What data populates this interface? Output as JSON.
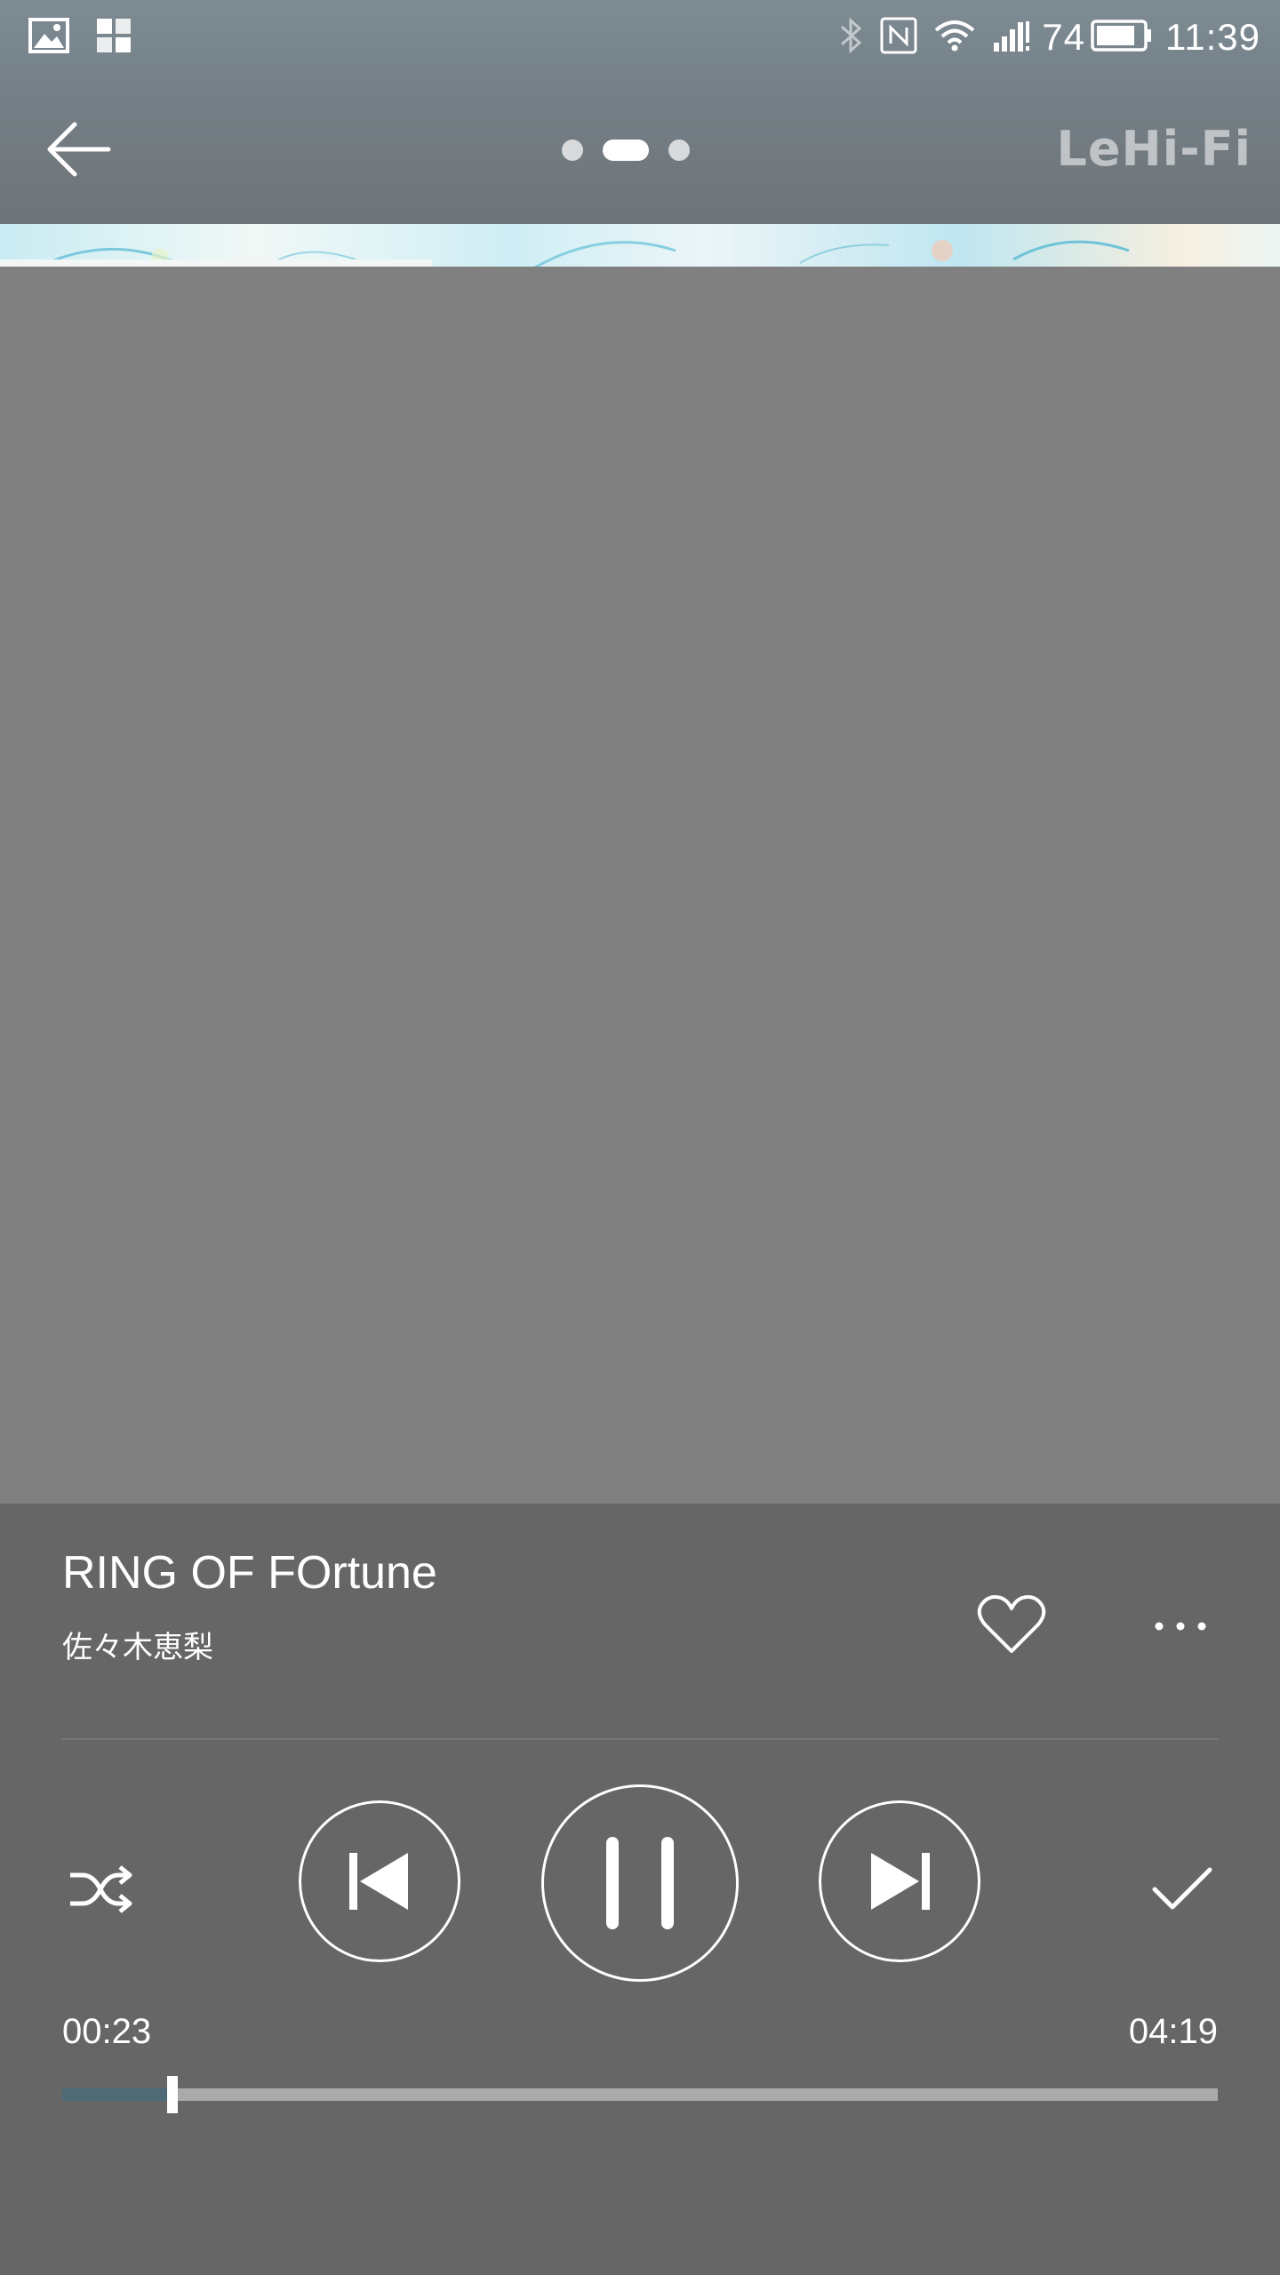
{
  "status_bar": {
    "left_icons": [
      "image-icon",
      "app-grid-icon"
    ],
    "right_icons": [
      "bluetooth-icon",
      "nfc-icon",
      "wifi-icon",
      "signal-icon",
      "battery-icon"
    ],
    "battery_percent": "74",
    "time": "11:39"
  },
  "app_bar": {
    "back_icon": "arrow-left-icon",
    "pages": 3,
    "active_page": 2,
    "brand": "LeHi-Fi"
  },
  "now_playing": {
    "title": "RING OF FOrtune",
    "artist": "佐々木恵梨"
  },
  "actions": {
    "favorite_icon": "heart-outline-icon",
    "more_icon": "more-horizontal-icon"
  },
  "controls": {
    "shuffle_icon": "shuffle-icon",
    "previous_icon": "skip-previous-icon",
    "play_pause_icon": "pause-icon",
    "next_icon": "skip-next-icon",
    "confirm_icon": "check-icon"
  },
  "progress": {
    "elapsed": "00:23",
    "total": "04:19",
    "fraction": 0.095
  },
  "colors": {
    "player_bg": "#666666",
    "artwork_bg": "#808080",
    "progress_fill": "#4e6a77",
    "progress_track": "#aaaaaa"
  }
}
